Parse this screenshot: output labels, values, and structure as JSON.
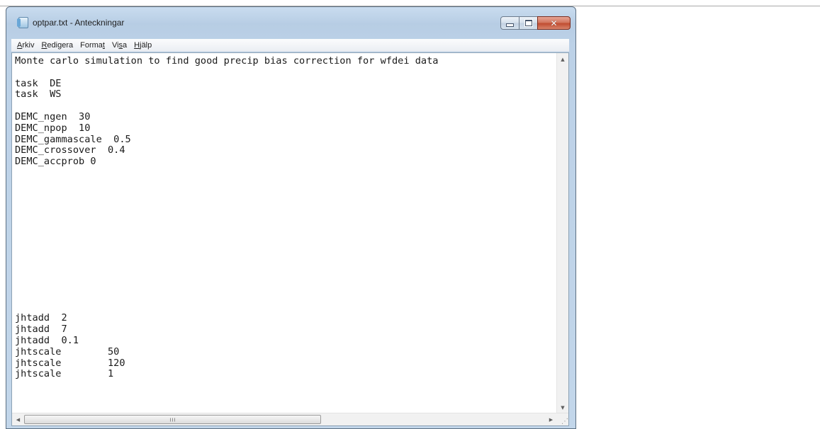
{
  "window": {
    "title": "optpar.txt - Anteckningar",
    "buttons": {
      "minimize": "minimize-icon",
      "maximize": "maximize-icon",
      "close": "close-icon"
    }
  },
  "menu": [
    {
      "pre": "",
      "key": "A",
      "post": "rkiv"
    },
    {
      "pre": "",
      "key": "R",
      "post": "edigera"
    },
    {
      "pre": "Forma",
      "key": "t",
      "post": ""
    },
    {
      "pre": "Vi",
      "key": "s",
      "post": "a"
    },
    {
      "pre": "",
      "key": "H",
      "post": "jälp"
    }
  ],
  "document": {
    "lines": [
      "Monte carlo simulation to find good precip bias correction for wfdei data",
      "",
      "task  DE",
      "task  WS",
      "",
      "DEMC_ngen  30",
      "DEMC_npop  10",
      "DEMC_gammascale  0.5",
      "DEMC_crossover  0.4",
      "DEMC_accprob 0",
      "",
      "",
      "",
      "",
      "",
      "",
      "",
      "",
      "",
      "",
      "",
      "",
      "",
      "jhtadd  2",
      "jhtadd  7",
      "jhtadd  0.1",
      "jhtscale        50",
      "jhtscale        120",
      "jhtscale        1"
    ]
  },
  "scrollbars": {
    "horizontal_thumb_fraction": 0.57,
    "vertical_arrows": [
      "up-arrow-icon",
      "down-arrow-icon"
    ],
    "horizontal_arrows": [
      "left-arrow-icon",
      "right-arrow-icon"
    ]
  },
  "colors": {
    "frame": "#bcd1e7",
    "close_button": "#c14d31",
    "editor_background": "#ffffff"
  }
}
